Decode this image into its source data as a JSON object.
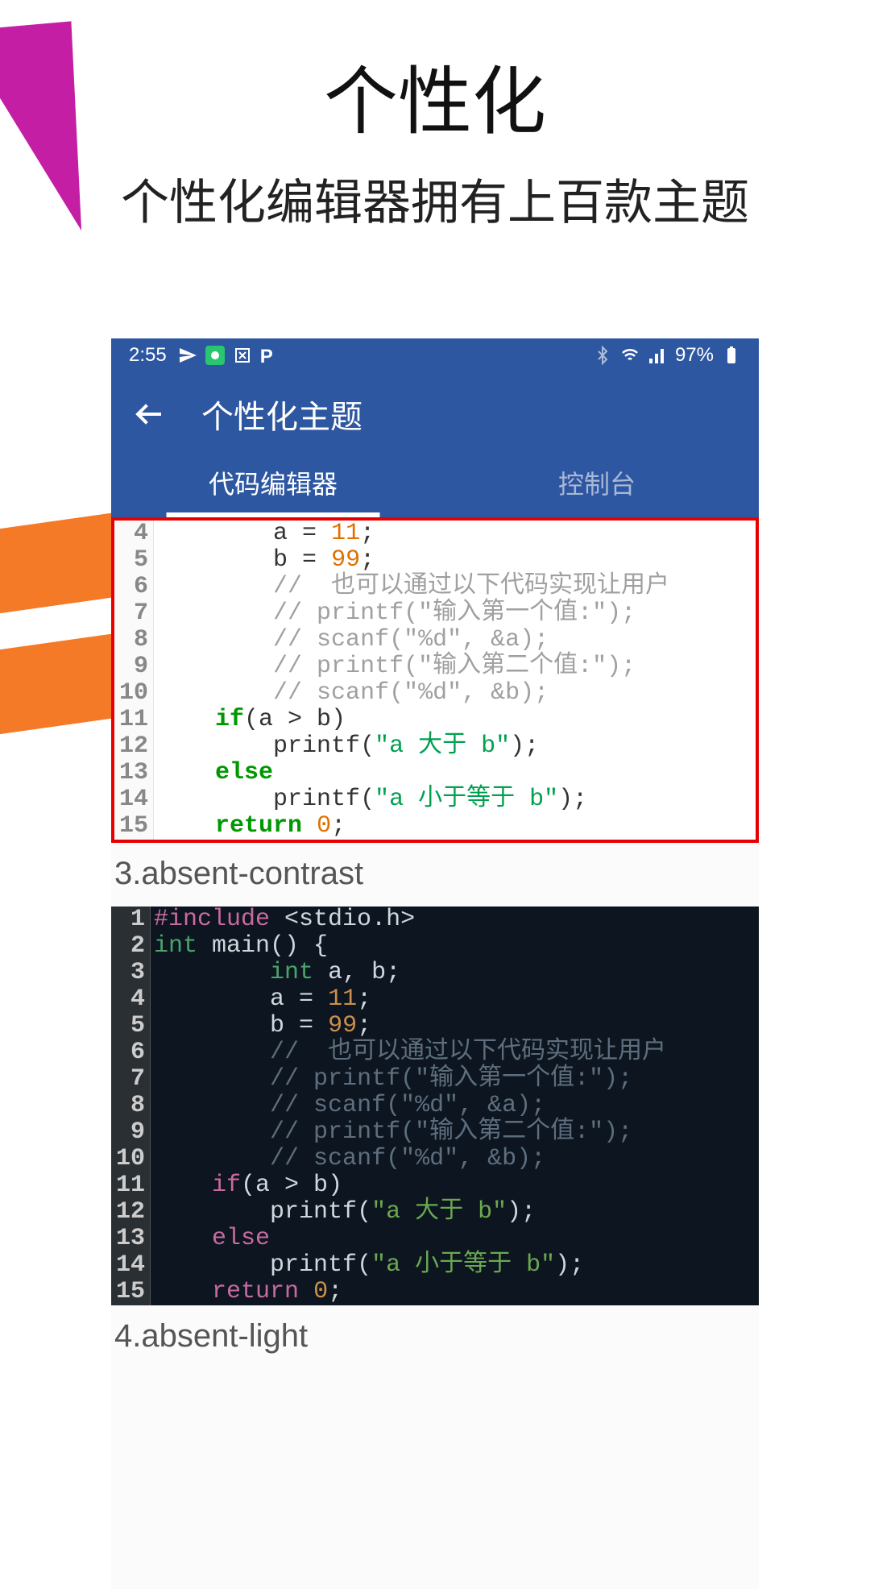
{
  "page": {
    "title": "个性化",
    "subtitle": "个性化编辑器拥有上百款主题"
  },
  "statusbar": {
    "time": "2:55",
    "battery": "97%"
  },
  "appbar": {
    "title": "个性化主题"
  },
  "tabs": {
    "editor": "代码编辑器",
    "console": "控制台"
  },
  "labels": {
    "theme3": "3.absent-contrast",
    "theme4": "4.absent-light"
  },
  "code_light": {
    "gutter": [
      "4",
      "5",
      "6",
      "7",
      "8",
      "9",
      "10",
      "11",
      "12",
      "13",
      "14",
      "15"
    ],
    "lines": [
      {
        "indent": "        ",
        "seg": [
          {
            "t": "a = ",
            "c": "plain-l"
          },
          {
            "t": "11",
            "c": "num-l"
          },
          {
            "t": ";",
            "c": "plain-l"
          }
        ]
      },
      {
        "indent": "        ",
        "seg": [
          {
            "t": "b = ",
            "c": "plain-l"
          },
          {
            "t": "99",
            "c": "num-l"
          },
          {
            "t": ";",
            "c": "plain-l"
          }
        ]
      },
      {
        "indent": "        ",
        "seg": [
          {
            "t": "//  也可以通过以下代码实现让用户",
            "c": "cm-l"
          }
        ]
      },
      {
        "indent": "        ",
        "seg": [
          {
            "t": "// printf(\"输入第一个值:\");",
            "c": "cm-l"
          }
        ]
      },
      {
        "indent": "        ",
        "seg": [
          {
            "t": "// scanf(\"%d\", &a);",
            "c": "cm-l"
          }
        ]
      },
      {
        "indent": "        ",
        "seg": [
          {
            "t": "// printf(\"输入第二个值:\");",
            "c": "cm-l"
          }
        ]
      },
      {
        "indent": "        ",
        "seg": [
          {
            "t": "// scanf(\"%d\", &b);",
            "c": "cm-l"
          }
        ]
      },
      {
        "indent": "    ",
        "seg": [
          {
            "t": "if",
            "c": "kw-l"
          },
          {
            "t": "(a > b)",
            "c": "plain-l"
          }
        ]
      },
      {
        "indent": "        ",
        "seg": [
          {
            "t": "printf(",
            "c": "plain-l"
          },
          {
            "t": "\"a 大于 b\"",
            "c": "str-l"
          },
          {
            "t": ");",
            "c": "plain-l"
          }
        ]
      },
      {
        "indent": "    ",
        "seg": [
          {
            "t": "else",
            "c": "kw-l"
          }
        ]
      },
      {
        "indent": "        ",
        "seg": [
          {
            "t": "printf(",
            "c": "plain-l"
          },
          {
            "t": "\"a 小于等于 b\"",
            "c": "str-l"
          },
          {
            "t": ");",
            "c": "plain-l"
          }
        ]
      },
      {
        "indent": "    ",
        "seg": [
          {
            "t": "return ",
            "c": "ret-l"
          },
          {
            "t": "0",
            "c": "num-l"
          },
          {
            "t": ";",
            "c": "plain-l"
          }
        ]
      }
    ]
  },
  "code_dark": {
    "gutter": [
      "1",
      "2",
      "3",
      "4",
      "5",
      "6",
      "7",
      "8",
      "9",
      "10",
      "11",
      "12",
      "13",
      "14",
      "15"
    ],
    "lines": [
      {
        "indent": "",
        "seg": [
          {
            "t": "#include ",
            "c": "inc-d"
          },
          {
            "t": "<stdio.h>",
            "c": "plain-d"
          }
        ]
      },
      {
        "indent": "",
        "seg": [
          {
            "t": "int ",
            "c": "type-d"
          },
          {
            "t": "main() {",
            "c": "plain-d"
          }
        ]
      },
      {
        "indent": "        ",
        "seg": [
          {
            "t": "int ",
            "c": "type-d"
          },
          {
            "t": "a, b;",
            "c": "plain-d"
          }
        ]
      },
      {
        "indent": "        ",
        "seg": [
          {
            "t": "a = ",
            "c": "plain-d"
          },
          {
            "t": "11",
            "c": "num-d"
          },
          {
            "t": ";",
            "c": "plain-d"
          }
        ]
      },
      {
        "indent": "        ",
        "seg": [
          {
            "t": "b = ",
            "c": "plain-d"
          },
          {
            "t": "99",
            "c": "num-d"
          },
          {
            "t": ";",
            "c": "plain-d"
          }
        ]
      },
      {
        "indent": "        ",
        "seg": [
          {
            "t": "//  也可以通过以下代码实现让用户",
            "c": "cm-d"
          }
        ]
      },
      {
        "indent": "        ",
        "seg": [
          {
            "t": "// printf(\"输入第一个值:\");",
            "c": "cm-d"
          }
        ]
      },
      {
        "indent": "        ",
        "seg": [
          {
            "t": "// scanf(\"%d\", &a);",
            "c": "cm-d"
          }
        ]
      },
      {
        "indent": "        ",
        "seg": [
          {
            "t": "// printf(\"输入第二个值:\");",
            "c": "cm-d"
          }
        ]
      },
      {
        "indent": "        ",
        "seg": [
          {
            "t": "// scanf(\"%d\", &b);",
            "c": "cm-d"
          }
        ]
      },
      {
        "indent": "    ",
        "seg": [
          {
            "t": "if",
            "c": "kw-d"
          },
          {
            "t": "(a > b)",
            "c": "plain-d"
          }
        ]
      },
      {
        "indent": "        ",
        "seg": [
          {
            "t": "printf(",
            "c": "plain-d"
          },
          {
            "t": "\"a 大于 b\"",
            "c": "str-d"
          },
          {
            "t": ");",
            "c": "plain-d"
          }
        ]
      },
      {
        "indent": "    ",
        "seg": [
          {
            "t": "else",
            "c": "kw-d"
          }
        ]
      },
      {
        "indent": "        ",
        "seg": [
          {
            "t": "printf(",
            "c": "plain-d"
          },
          {
            "t": "\"a 小于等于 b\"",
            "c": "str-d"
          },
          {
            "t": ");",
            "c": "plain-d"
          }
        ]
      },
      {
        "indent": "    ",
        "seg": [
          {
            "t": "return ",
            "c": "kw-d"
          },
          {
            "t": "0",
            "c": "num-d"
          },
          {
            "t": ";",
            "c": "plain-d"
          }
        ]
      }
    ]
  }
}
